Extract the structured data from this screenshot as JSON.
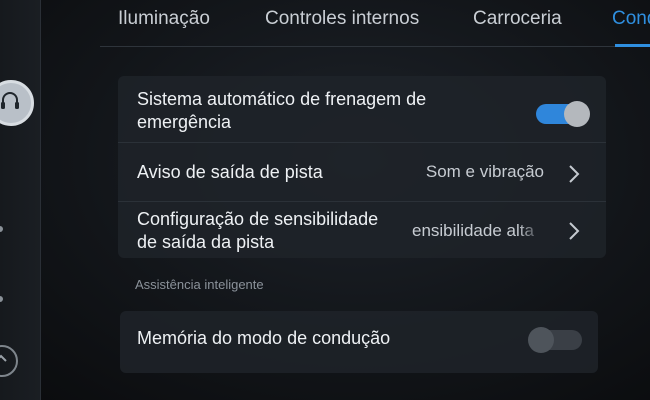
{
  "tabs": [
    {
      "label": "Iluminação",
      "active": false
    },
    {
      "label": "Controles internos",
      "active": false
    },
    {
      "label": "Carroceria",
      "active": false
    },
    {
      "label": "Cond",
      "active": true
    }
  ],
  "settings": {
    "items": [
      {
        "label_line1": "Sistema automático de frenagem de",
        "label_line2": "emergência",
        "control": "toggle",
        "state": "on"
      },
      {
        "label": "Aviso de saída de pista",
        "value": "Som e vibração",
        "control": "chevron"
      },
      {
        "label_line1": "Configuração de sensibilidade",
        "label_line2": "de saída da pista",
        "value": "ensibilidade alta",
        "control": "chevron"
      }
    ]
  },
  "assist": {
    "section_title": "Assistência inteligente",
    "items": [
      {
        "label": "Memória do modo de condução",
        "control": "toggle",
        "state": "off"
      }
    ]
  },
  "colors": {
    "accent": "#2f8fe0",
    "toggle_on": "#2f86db"
  },
  "icons": [
    "headset-icon",
    "chevron-right-icon",
    "chevron-up-icon"
  ]
}
